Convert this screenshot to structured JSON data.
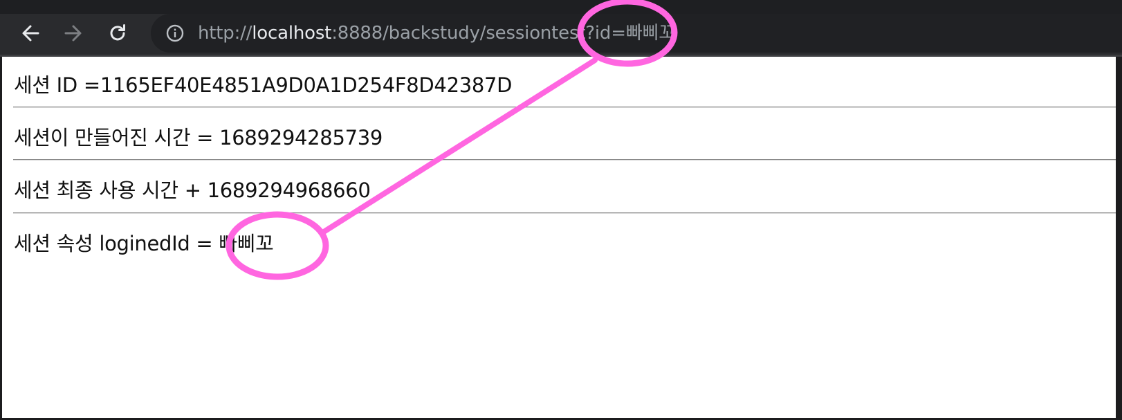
{
  "browser": {
    "url_scheme": "http://",
    "url_host": "localhost",
    "url_rest": ":8888/backstudy/sessiontest?id=빠삐꼬",
    "icons": {
      "back": "arrow-left-icon",
      "forward": "arrow-right-icon",
      "reload": "reload-icon",
      "info": "info-circle-icon"
    }
  },
  "session": {
    "id_label": "세션 ID =1165EF40E4851A9D0A1D254F8D42387D",
    "created_label": "세션이 만들어진 시간 = 1689294285739",
    "last_access_label": "세션 최종 사용 시간 + 1689294968660",
    "attr_label": "세션 속성 loginedId = 빠삐꼬"
  },
  "annotation": {
    "color": "#ff66e0"
  }
}
